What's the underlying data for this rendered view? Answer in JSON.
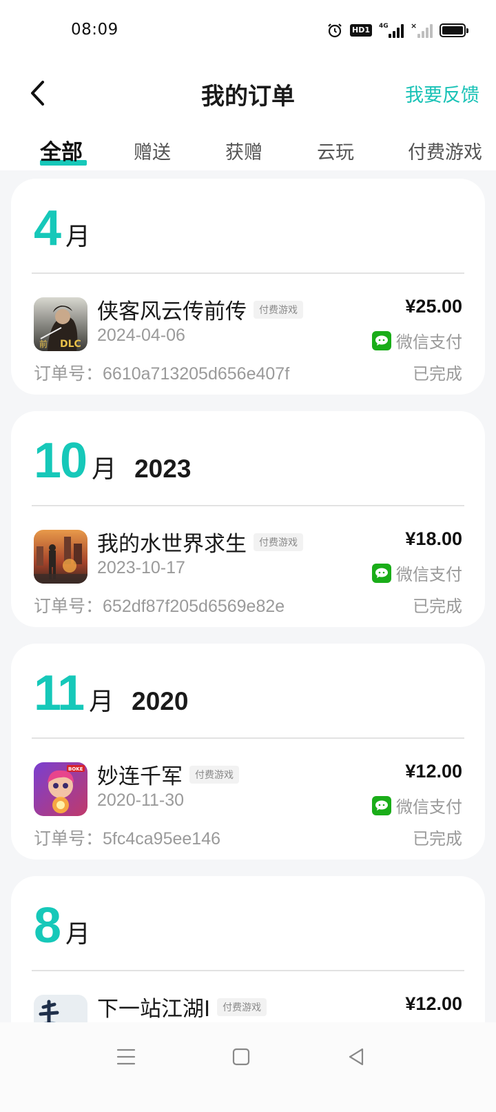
{
  "status_bar": {
    "time": "08:09",
    "hd_label": "HD1",
    "network_label": "4G"
  },
  "header": {
    "title": "我的订单",
    "feedback": "我要反馈"
  },
  "tabs": [
    {
      "label": "全部",
      "active": true
    },
    {
      "label": "赠送",
      "active": false
    },
    {
      "label": "获赠",
      "active": false
    },
    {
      "label": "云玩",
      "active": false
    },
    {
      "label": "付费游戏",
      "active": false
    }
  ],
  "groups": [
    {
      "month": "4",
      "unit": "月",
      "year": "",
      "orders": [
        {
          "title": "侠客风云传前传",
          "tag": "付费游戏",
          "date": "2024-04-06",
          "price": "¥25.00",
          "payment": "微信支付",
          "order_label": "订单号：",
          "order_no": "6610a713205d656e407f",
          "status": "已完成",
          "icon": "xiake-icon"
        }
      ]
    },
    {
      "month": "10",
      "unit": "月",
      "year": "2023",
      "orders": [
        {
          "title": "我的水世界求生",
          "tag": "付费游戏",
          "date": "2023-10-17",
          "price": "¥18.00",
          "payment": "微信支付",
          "order_label": "订单号：",
          "order_no": "652df87f205d6569e82e",
          "status": "已完成",
          "icon": "water-world-icon"
        }
      ]
    },
    {
      "month": "11",
      "unit": "月",
      "year": "2020",
      "orders": [
        {
          "title": "妙连千军",
          "tag": "付费游戏",
          "date": "2020-11-30",
          "price": "¥12.00",
          "payment": "微信支付",
          "order_label": "订单号：",
          "order_no": "5fc4ca95ee146",
          "status": "已完成",
          "icon": "miaolian-icon"
        }
      ]
    },
    {
      "month": "8",
      "unit": "月",
      "year": "",
      "orders": [
        {
          "title": "下一站江湖Ⅰ",
          "tag": "付费游戏",
          "price": "¥12.00",
          "icon": "jianghu-icon"
        }
      ]
    }
  ],
  "icon_art": {
    "xiake_dlc_label": "DLC",
    "miaolian_label": "BOKE"
  },
  "colors": {
    "accent": "#16c8b9",
    "feedback": "#19c2b6",
    "wechat": "#1aad19"
  }
}
